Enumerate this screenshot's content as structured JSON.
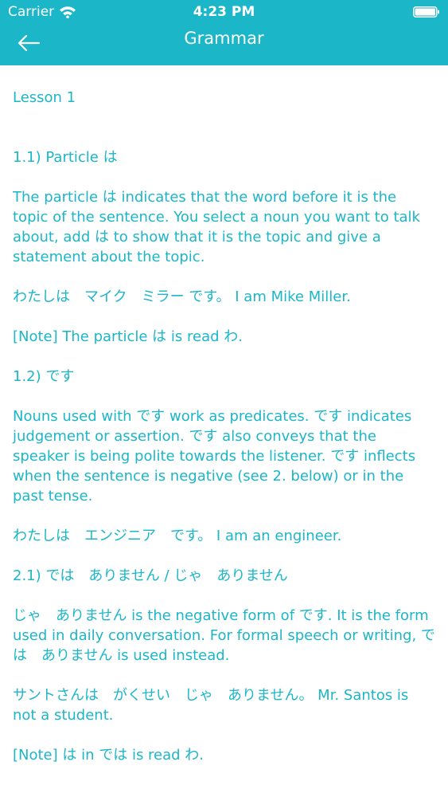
{
  "status_bar": {
    "carrier": "Carrier",
    "time": "4:23 PM",
    "icons": [
      "wifi-icon",
      "battery-icon"
    ]
  },
  "nav": {
    "title": "Grammar",
    "back_icon": "arrow-left-icon"
  },
  "colors": {
    "accent": "#1cb6c9",
    "background": "#ffffff",
    "header_text": "#ffffff"
  },
  "content": {
    "lesson_title": "Lesson 1",
    "paragraphs": [
      "1.1) Particle は",
      "The particle は indicates that the word before it is the topic of the sentence. You select a noun you want to talk about, add は to show that it is the topic and give a statement about the topic.",
      "わたしは　マイク　ミラー です。 I am Mike Miller.",
      "[Note] The particle は is read わ.",
      "1.2) です",
      "Nouns used with です work as predicates. です indicates judgement or assertion. です also conveys that the speaker is being polite towards the listener. です inflects when the sentence is negative (see 2. below) or in the past tense.",
      "わたしは　エンジニア　です。 I am an engineer.",
      "2.1) では　ありません / じゃ　ありません",
      "じゃ　ありません is the negative form of です. It is the form used in daily conversation. For formal speech or writing, では　ありません is used instead.",
      "サントさんは　がくせい　じゃ　ありません。 Mr. Santos is not a student.",
      "[Note] は in では is read わ."
    ]
  }
}
